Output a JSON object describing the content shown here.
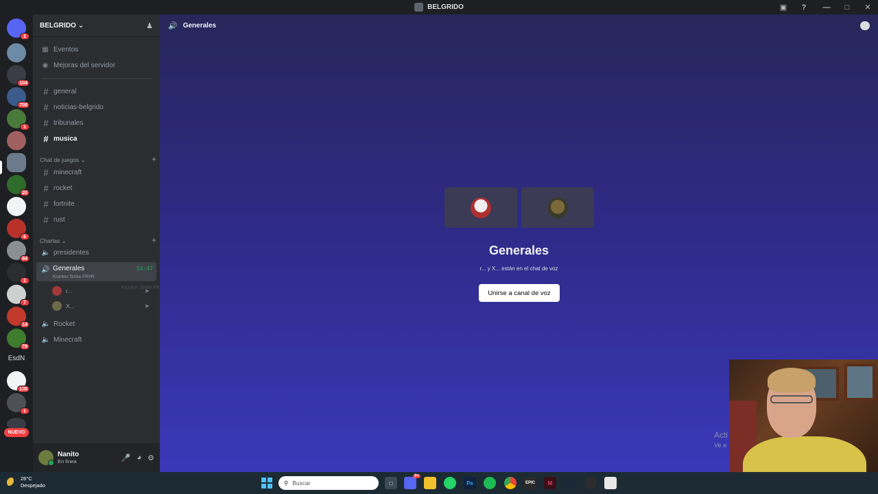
{
  "window": {
    "title": "BELGRIDO"
  },
  "servers": {
    "badges": [
      "2",
      "104",
      "708",
      "1",
      "20",
      "6",
      "94",
      "1",
      "7",
      "14",
      "78",
      "135",
      "1"
    ],
    "text_server": "EsdN",
    "new_label": "NUEVO"
  },
  "guild": {
    "name": "BELGRIDO",
    "top_items": [
      {
        "label": "Eventos",
        "icon": "calendar-icon"
      },
      {
        "label": "Mejoras del servidor",
        "icon": "boost-icon"
      }
    ],
    "channels": [
      "general",
      "noticias-belgrido",
      "tribunales",
      "musica"
    ],
    "categories": [
      {
        "label": "Chat de juegos",
        "channels": [
          "minecraft",
          "rocket",
          "fortnite",
          "rust"
        ]
      },
      {
        "label": "Charlas"
      }
    ],
    "voice_channels": {
      "presidentes": "presidentes",
      "active": {
        "name": "Generales",
        "activity": "Krunker Strike FRVR",
        "time": "54:47"
      },
      "users": [
        {
          "name": "r..."
        },
        {
          "name": "X..."
        }
      ],
      "rocket": "Rocket",
      "minecraft": "Minecraft"
    },
    "hover_tooltip": "Krunker Strike FRVR"
  },
  "user": {
    "name": "Nanito",
    "status": "En línea"
  },
  "main": {
    "channel_title": "Generales",
    "vc_title": "Generales",
    "vc_subtitle": "r... y X... están en el chat de voz",
    "join_label": "Unirse a canal de voz",
    "activate_line1": "Acti",
    "activate_line2": "Ve a"
  },
  "taskbar": {
    "temperature": "28°C",
    "weather": "Despejado",
    "search_placeholder": "Buscar",
    "discord_badge": "9+"
  }
}
